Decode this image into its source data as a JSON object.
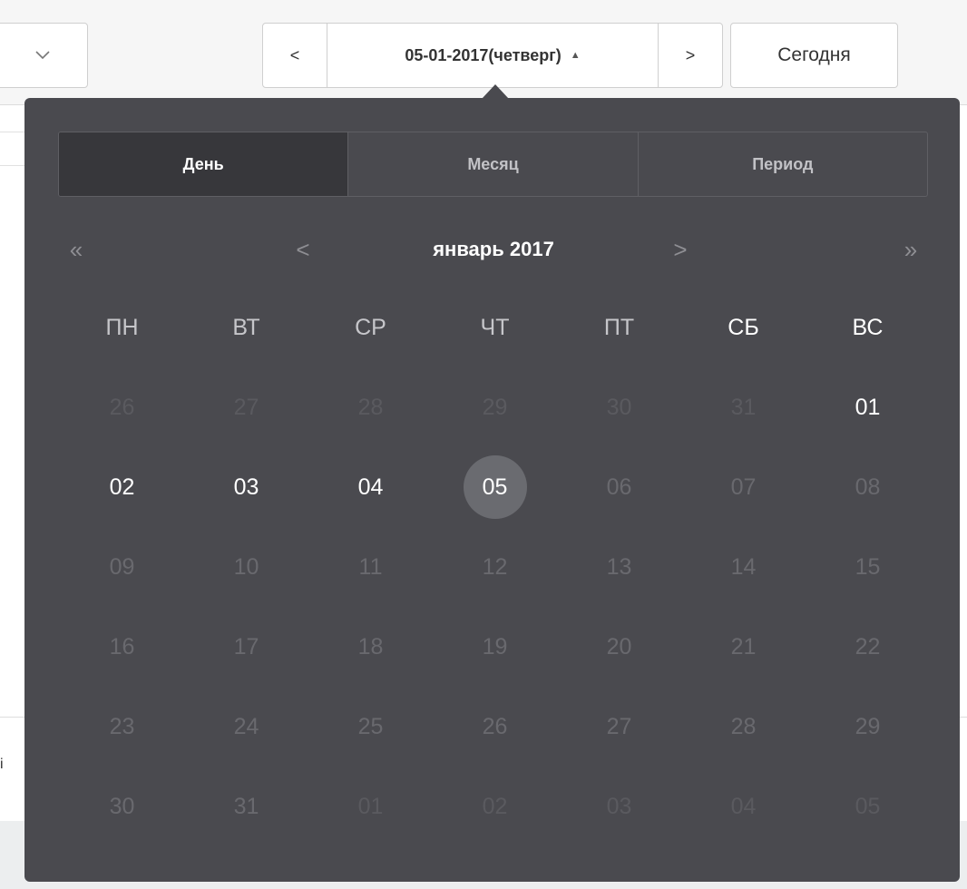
{
  "toolbar": {
    "dropdown_icon": "chevron-down-icon",
    "prev_glyph": "<",
    "date_label": "05-01-2017(четверг)",
    "caret_glyph": "▲",
    "next_glyph": ">",
    "today_label": "Сегодня",
    "background_char": "i"
  },
  "calendar": {
    "tabs": [
      {
        "label": "День",
        "active": true
      },
      {
        "label": "Месяц",
        "active": false
      },
      {
        "label": "Период",
        "active": false
      }
    ],
    "nav": {
      "prev_year": "«",
      "prev_month": "<",
      "month_label": "январь 2017",
      "next_month": ">",
      "next_year": "»"
    },
    "weekdays": [
      "ПН",
      "ВТ",
      "СР",
      "ЧТ",
      "ПТ",
      "СБ",
      "ВС"
    ],
    "weeks": [
      [
        "26",
        "27",
        "28",
        "29",
        "30",
        "31",
        "01"
      ],
      [
        "02",
        "03",
        "04",
        "05",
        "06",
        "07",
        "08"
      ],
      [
        "09",
        "10",
        "11",
        "12",
        "13",
        "14",
        "15"
      ],
      [
        "16",
        "17",
        "18",
        "19",
        "20",
        "21",
        "22"
      ],
      [
        "23",
        "24",
        "25",
        "26",
        "27",
        "28",
        "29"
      ],
      [
        "30",
        "31",
        "01",
        "02",
        "03",
        "04",
        "05"
      ]
    ],
    "selected_day": "05",
    "colors": {
      "popup_bg": "#4a4a4f",
      "active_tab_bg": "#37373b",
      "selected_circle": "#6a6b70",
      "enabled_day": "#ffffff",
      "disabled_day": "#69696e"
    }
  }
}
